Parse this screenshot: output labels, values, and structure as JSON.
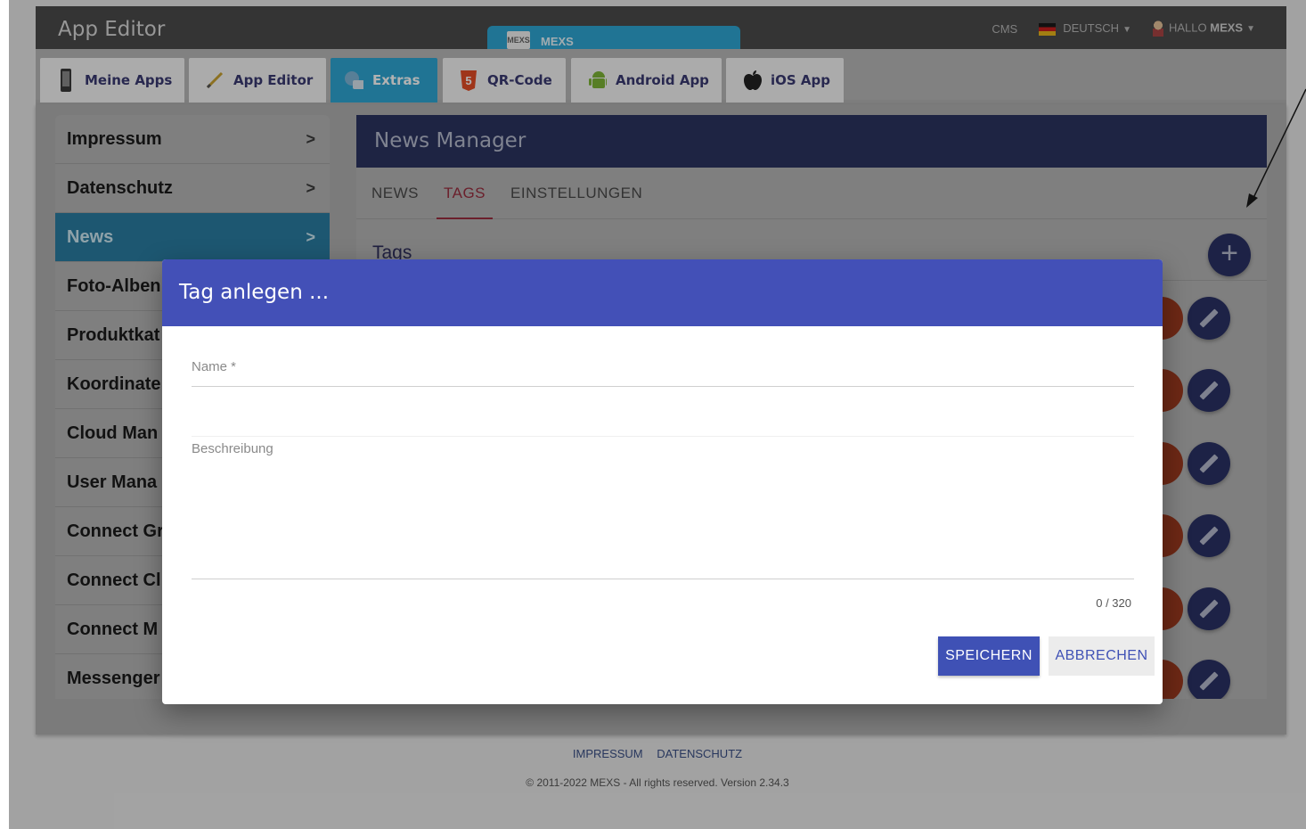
{
  "header": {
    "app_title": "App Editor",
    "center_tab": "MEXS",
    "center_tab_logo": "MEXS",
    "cms": "CMS",
    "language": "DEUTSCH",
    "greeting": "HALLO",
    "user": "MEXS"
  },
  "nav": {
    "tabs": [
      {
        "label": "Meine Apps",
        "icon": "phone-icon"
      },
      {
        "label": "App Editor",
        "icon": "pencil-icon"
      },
      {
        "label": "Extras",
        "icon": "extras-icon",
        "active": true
      },
      {
        "label": "QR-Code",
        "icon": "html5-icon",
        "icon_text": "5"
      },
      {
        "label": "Android App",
        "icon": "android-icon"
      },
      {
        "label": "iOS App",
        "icon": "apple-icon"
      }
    ]
  },
  "sidebar": {
    "items": [
      {
        "label": "Impressum",
        "chevron": ">"
      },
      {
        "label": "Datenschutz",
        "chevron": ">"
      },
      {
        "label": "News",
        "chevron": ">",
        "active": true
      },
      {
        "label": "Foto-Alben"
      },
      {
        "label": "Produktkat"
      },
      {
        "label": "Koordinate"
      },
      {
        "label": "Cloud Man"
      },
      {
        "label": "User Mana"
      },
      {
        "label": "Connect Gr"
      },
      {
        "label": "Connect Cl"
      },
      {
        "label": "Connect M"
      },
      {
        "label": "Messenger"
      }
    ]
  },
  "news_manager": {
    "title": "News Manager",
    "tabs": [
      {
        "label": "NEWS"
      },
      {
        "label": "TAGS",
        "active": true
      },
      {
        "label": "EINSTELLUNGEN"
      }
    ],
    "section_title": "Tags",
    "add_icon": "+"
  },
  "dialog": {
    "title": "Tag anlegen ...",
    "name_label": "Name *",
    "name_value": "",
    "description_label": "Beschreibung",
    "description_value": "",
    "counter": "0 / 320",
    "save_label": "SPEICHERN",
    "cancel_label": "ABBRECHEN"
  },
  "footer": {
    "links": [
      "IMPRESSUM",
      "DATENSCHUTZ"
    ],
    "copyright": "© 2011-2022 MEXS - All rights reserved. Version 2.34.3"
  },
  "colors": {
    "accent_blue": "#3f51b5",
    "nav_active": "#2ea7d4",
    "tab_active": "#e53a5c"
  }
}
